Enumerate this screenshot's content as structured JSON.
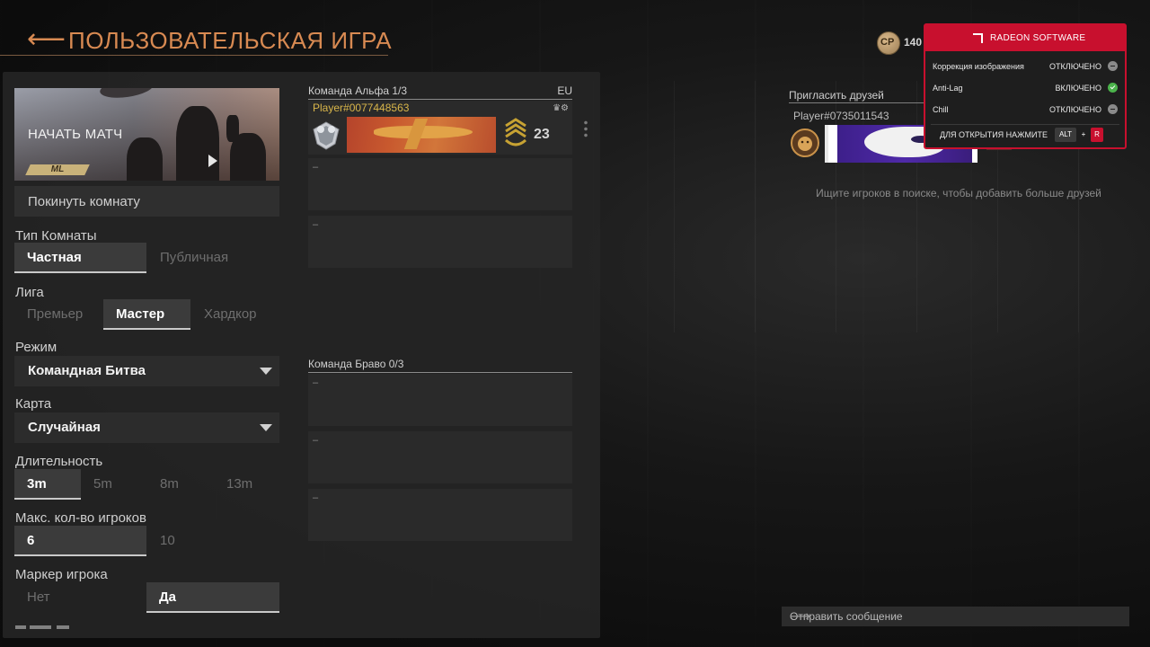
{
  "header": {
    "back_glyph": "⟵",
    "title": "ПОЛЬЗОВАТЕЛЬСКАЯ ИГРА"
  },
  "hero": {
    "label": "НАЧАТЬ МАТЧ",
    "logo_text": "ML"
  },
  "leave_button": "Покинуть комнату",
  "room_type": {
    "label": "Тип Комнаты",
    "options": [
      "Частная",
      "Публичная"
    ],
    "selected": "Частная"
  },
  "league": {
    "label": "Лига",
    "options": [
      "Премьер",
      "Мастер",
      "Хардкор"
    ],
    "selected": "Мастер"
  },
  "mode": {
    "label": "Режим",
    "value": "Командная Битва"
  },
  "map": {
    "label": "Карта",
    "value": "Случайная"
  },
  "duration": {
    "label": "Длительность",
    "options": [
      "3m",
      "5m",
      "8m",
      "13m"
    ],
    "selected": "3m"
  },
  "max_players": {
    "label": "Макс. кол-во игроков",
    "options": [
      "6",
      "10"
    ],
    "selected": "6"
  },
  "player_marker": {
    "label": "Маркер игрока",
    "options": [
      "Нет",
      "Да"
    ],
    "selected": "Да"
  },
  "team_alpha": {
    "title": "Команда Альфа 1/3",
    "region": "EU",
    "player": {
      "name": "Player#0077448563",
      "icons": "♛⚙",
      "rank": "23"
    },
    "empty_slots": [
      "–",
      "–"
    ]
  },
  "team_bravo": {
    "title": "Команда Браво 0/3",
    "empty_slots": [
      "–",
      "–",
      "–"
    ]
  },
  "friends": {
    "title": "Пригласить друзей",
    "friend_name": "Player#0735011543",
    "hint": "Ищите игроков в поиске, чтобы добавить больше друзей"
  },
  "currency": {
    "icon_text": "CP",
    "value": "140"
  },
  "radeon": {
    "title": "RADEON SOFTWARE",
    "rows": [
      {
        "key": "Коррекция изображения",
        "value": "ОТКЛЮЧЕНО",
        "state": "off"
      },
      {
        "key": "Anti-Lag",
        "value": "ВКЛЮЧЕНО",
        "state": "on"
      },
      {
        "key": "Chill",
        "value": "ОТКЛЮЧЕНО",
        "state": "off"
      }
    ],
    "footer": "ДЛЯ ОТКРЫТИЯ НАЖМИТЕ",
    "key1": "ALT",
    "plus": "+",
    "key2": "R"
  },
  "message": {
    "placeholder": "Отправить сообщение",
    "send_glyph": "⟶"
  },
  "colors": {
    "accent": "#d88a52",
    "gold_name": "#d9b64a",
    "radeon_red": "#c8102e",
    "status_on": "#4bb34b"
  }
}
